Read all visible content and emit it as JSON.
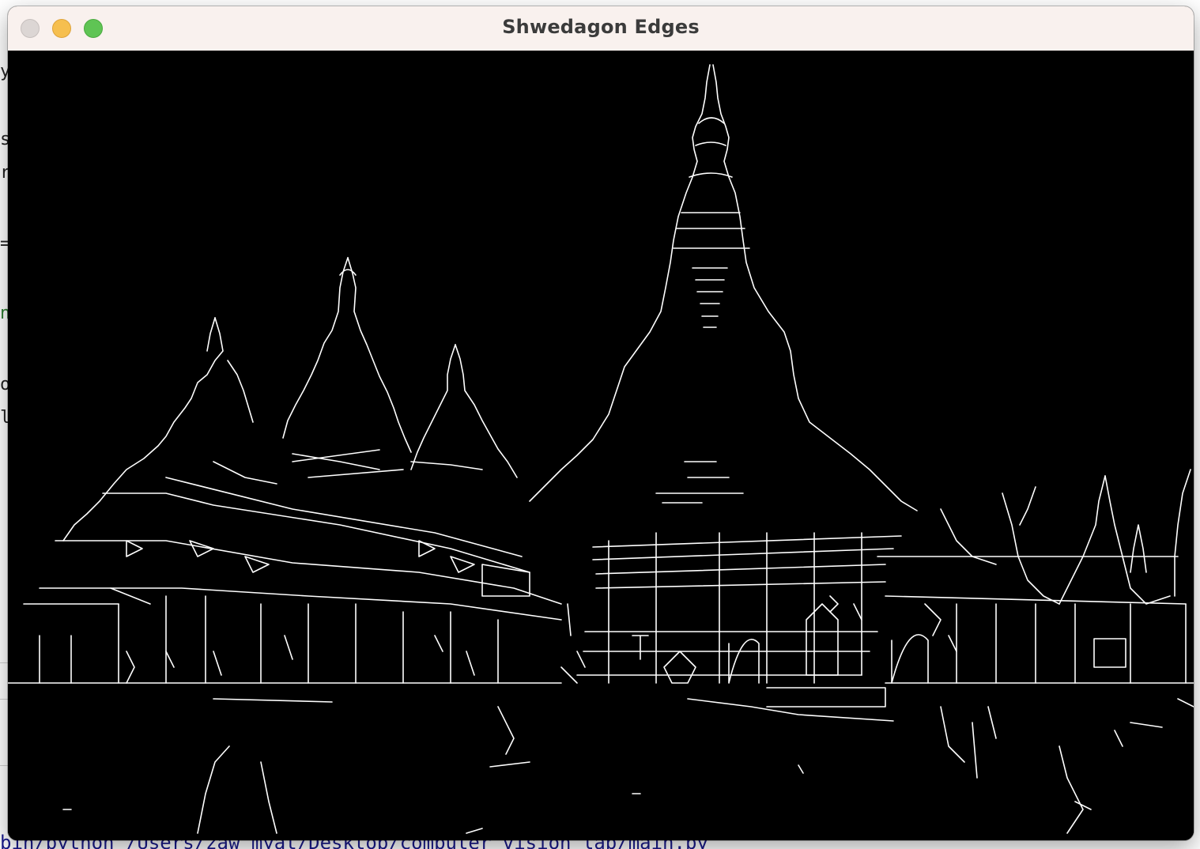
{
  "window": {
    "title": "Shwedagon Edges",
    "buttons": {
      "close": "close-icon",
      "minimize": "minimize-icon",
      "zoom": "zoom-icon"
    }
  },
  "image": {
    "description_icon": "edge-detection-image",
    "background_color": "#000000",
    "stroke_color": "#ffffff"
  },
  "background_editor": {
    "terminal_command": "bin/python /Users/zaw_myat/Desktop/computer_vision_lab/main.py",
    "left_glyphs": [
      "y",
      "s",
      "r",
      "=",
      "n",
      "o",
      "l"
    ]
  },
  "colors": {
    "titlebar": "#f9f1ee",
    "title_text": "#3b3b3b",
    "close": "#dcd6d4",
    "minimize": "#f6bf4f",
    "zoom": "#5fc454"
  }
}
